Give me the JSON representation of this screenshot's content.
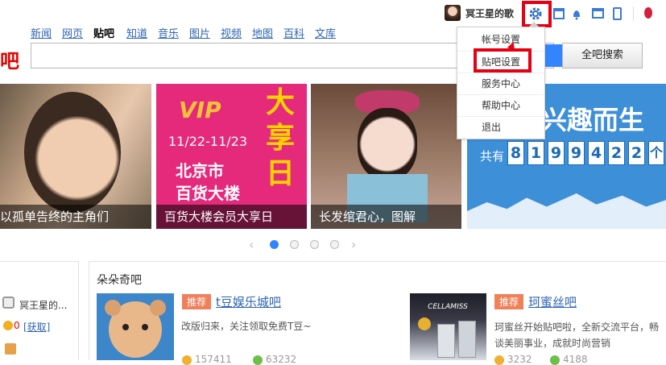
{
  "user": {
    "name": "冥王星的歌"
  },
  "nav": {
    "items": [
      "新闻",
      "网页",
      "贴吧",
      "知道",
      "音乐",
      "图片",
      "视频",
      "地图",
      "百科",
      "文库"
    ],
    "current": "贴吧"
  },
  "logo": {
    "char": "吧"
  },
  "search": {
    "placeholder": "",
    "button": "全吧搜索"
  },
  "settings_menu": {
    "items": [
      "帐号设置",
      "贴吧设置",
      "服务中心",
      "帮助中心",
      "退出"
    ]
  },
  "banner": {
    "captions": [
      "以孤单告终的主角们",
      "百货大楼会员大享日",
      "长发绾君心，图解",
      ""
    ],
    "vip_tile": {
      "vip": "VIP",
      "date": "11/22-11/23",
      "line1": "北京市",
      "line2": "百货大楼",
      "big": "大享日"
    },
    "interest_tile": {
      "slogan": "兴趣而生",
      "prefix": "共有",
      "digits": [
        "8",
        "1",
        "9",
        "9",
        "4",
        "2",
        "2",
        "个"
      ]
    }
  },
  "side": {
    "username": "冥王星的...",
    "coins": "0",
    "get": "[获取]"
  },
  "section": {
    "title": "朵朵奇吧"
  },
  "cards": [
    {
      "tag": "推荐",
      "name": "t豆娱乐城吧",
      "desc": "改版归来，关注领取免费T豆~",
      "stat1": "157411",
      "stat2": "63232"
    },
    {
      "tag": "推荐",
      "name": "珂蜜丝吧",
      "desc": "珂蜜丝开始贴吧啦，全新交流平台，畅谈美丽事业，成就时尚营销",
      "stat1": "3232",
      "stat2": "4188"
    }
  ],
  "colors": {
    "accent_red": "#e60012",
    "link_blue": "#2d64b3",
    "tag_orange": "#f0805a"
  }
}
